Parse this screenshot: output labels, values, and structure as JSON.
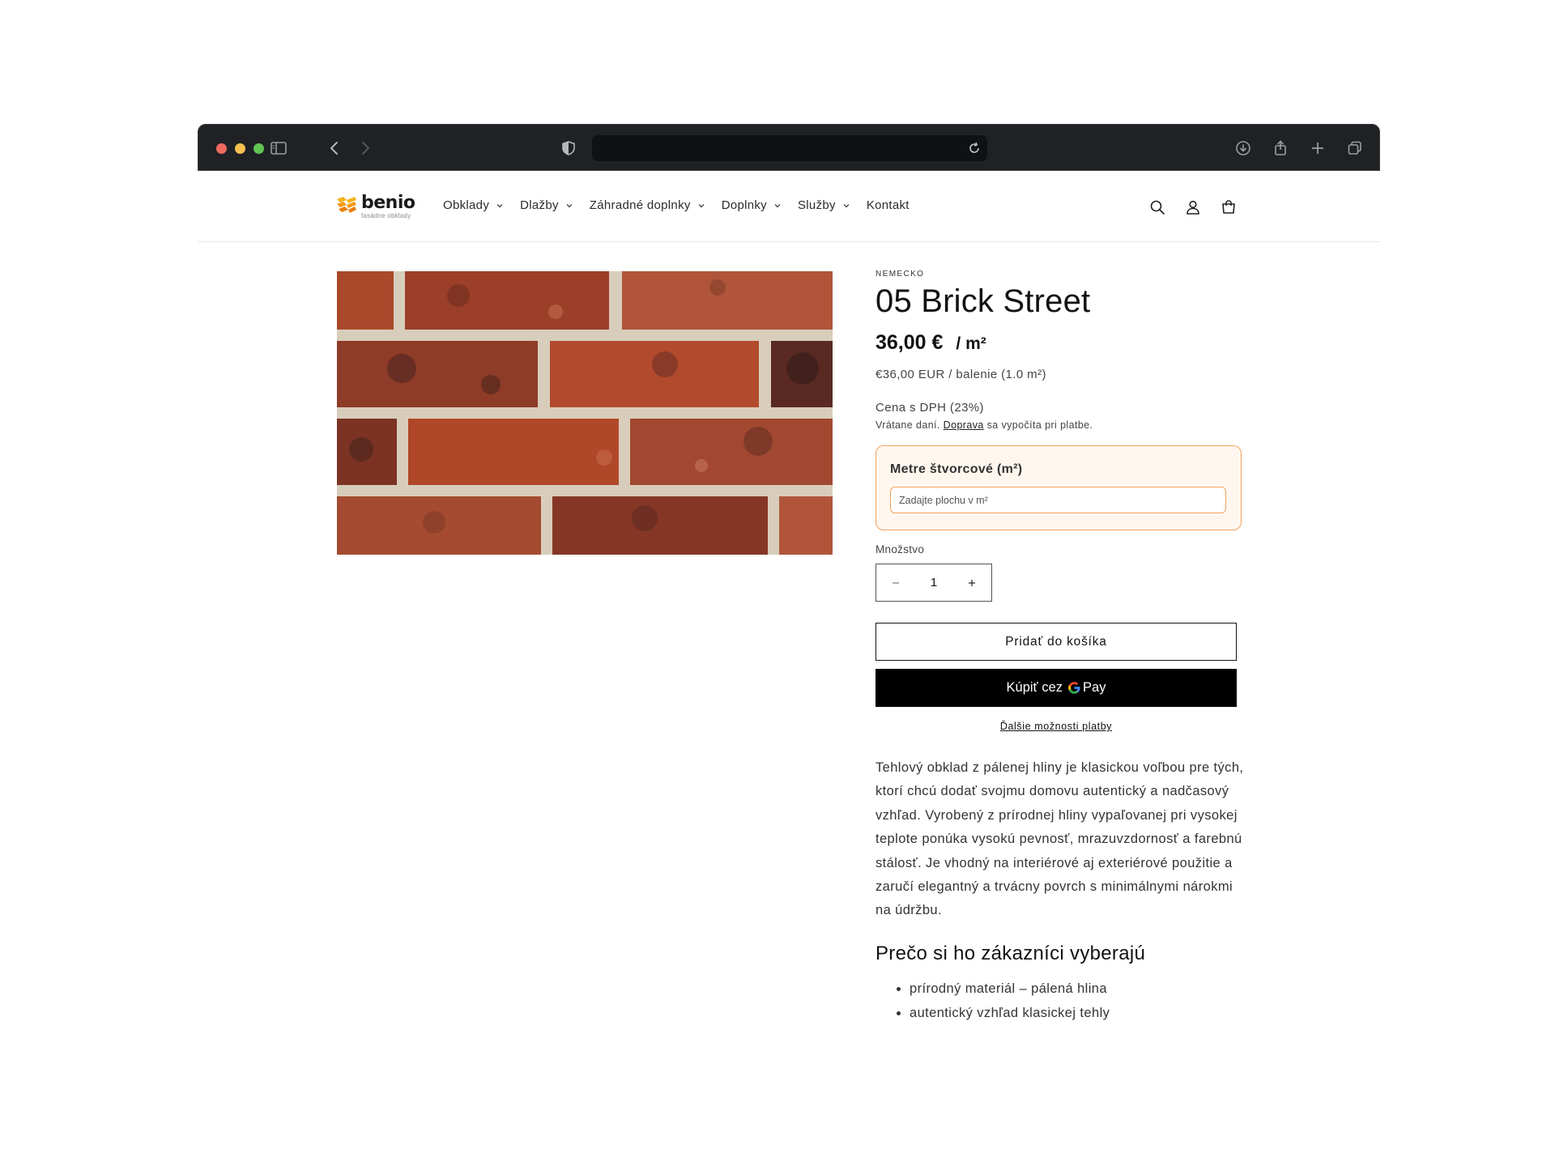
{
  "header": {
    "logo": {
      "name": "benio",
      "tagline": "fasádne obklady"
    },
    "nav": [
      {
        "label": "Obklady",
        "has_dropdown": true
      },
      {
        "label": "Dlažby",
        "has_dropdown": true
      },
      {
        "label": "Záhradné doplnky",
        "has_dropdown": true
      },
      {
        "label": "Doplnky",
        "has_dropdown": true
      },
      {
        "label": "Služby",
        "has_dropdown": true
      },
      {
        "label": "Kontakt",
        "has_dropdown": false
      }
    ],
    "icons": [
      "search-icon",
      "account-icon",
      "cart-icon"
    ]
  },
  "product": {
    "vendor": "NEMECKO",
    "title": "05 Brick Street",
    "price": "36,00 €",
    "price_unit": "/ m²",
    "unit_price": "€36,00 EUR / balenie (1.0 m²)",
    "vat_label": "Cena s DPH (23%)",
    "tax_note_prefix": "Vrátane daní.",
    "tax_note_link": "Doprava",
    "tax_note_suffix": "sa vypočíta pri platbe.",
    "area_label": "Metre štvorcové (m²)",
    "area_placeholder": "Zadajte plochu v m²",
    "quantity_label": "Množstvo",
    "quantity_value": "1",
    "add_to_cart": "Pridať do košíka",
    "gpay_prefix": "Kúpiť cez",
    "gpay_g": "G",
    "gpay_pay": "Pay",
    "more_payment": "Ďalšie možnosti platby",
    "description": "Tehlový obklad z pálenej hliny je klasickou voľbou pre tých, ktorí chcú dodať svojmu domovu autentický a nadčasový vzhľad. Vyrobený z prírodnej hliny vypaľovanej pri vysokej teplote ponúka vysokú pevnosť, mrazuvzdornosť a farebnú stálosť. Je vhodný na interiérové aj exteriérové použitie a zaručí elegantný a trvácny povrch s minimálnymi nárokmi na údržbu.",
    "why_heading": "Prečo si ho zákazníci vyberajú",
    "features": [
      "prírodný materiál – pálená hlina",
      "autentický vzhľad klasickej tehly"
    ]
  },
  "colors": {
    "accent_orange": "#f2a25d",
    "accent_bg": "#fff7ef",
    "text": "#121212",
    "chrome": "#1f2124",
    "brick": "#a9492c",
    "mortar": "#d8cdbb"
  }
}
